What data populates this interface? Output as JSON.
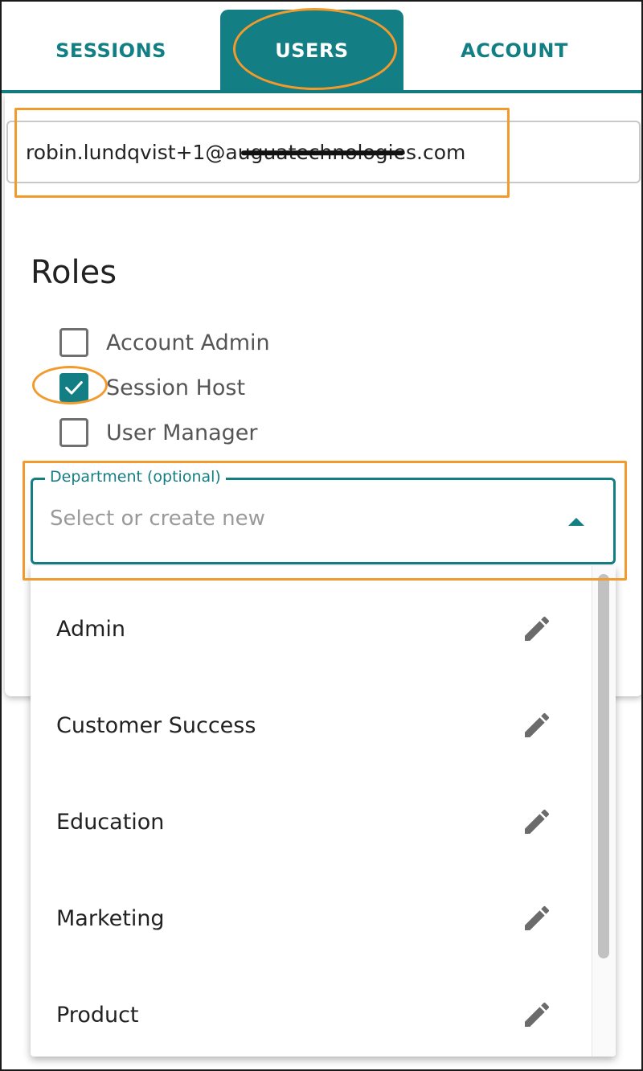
{
  "tabs": [
    {
      "label": "SESSIONS",
      "active": false
    },
    {
      "label": "USERS",
      "active": true
    },
    {
      "label": "ACCOUNT",
      "active": false
    }
  ],
  "user": {
    "email_prefix": "robin.lundqvist+1@a",
    "email_redacted": "uguatechnologie",
    "email_suffix": "s.com"
  },
  "roles": {
    "title": "Roles",
    "items": [
      {
        "label": "Account Admin",
        "checked": false
      },
      {
        "label": "Session Host",
        "checked": true
      },
      {
        "label": "User Manager",
        "checked": false
      }
    ]
  },
  "department": {
    "legend": "Department (optional)",
    "placeholder": "Select or create new",
    "options": [
      {
        "label": "Admin"
      },
      {
        "label": "Customer Success"
      },
      {
        "label": "Education"
      },
      {
        "label": "Marketing"
      },
      {
        "label": "Product"
      }
    ]
  },
  "colors": {
    "accent": "#137e84",
    "highlight": "#f39a2c",
    "placeholder": "#9a9a9a"
  },
  "icons": {
    "checkmark": "check-icon",
    "dropdown": "caret-up-icon",
    "edit": "pencil-icon"
  }
}
